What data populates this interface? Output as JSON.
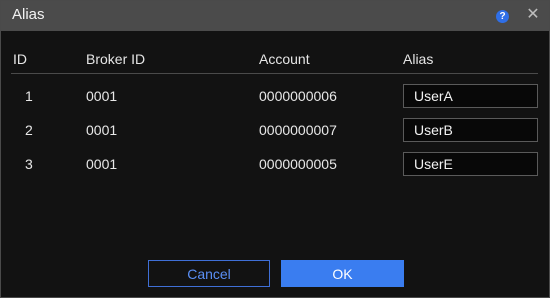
{
  "window": {
    "title": "Alias",
    "help_icon": "help-icon",
    "close_icon": "close-icon",
    "help_glyph": "?",
    "close_glyph": "✕"
  },
  "table": {
    "headers": {
      "id": "ID",
      "broker_id": "Broker ID",
      "account": "Account",
      "alias": "Alias"
    },
    "rows": [
      {
        "id": "1",
        "broker_id": "0001",
        "account": "0000000006",
        "alias": "UserA"
      },
      {
        "id": "2",
        "broker_id": "0001",
        "account": "0000000007",
        "alias": "UserB"
      },
      {
        "id": "3",
        "broker_id": "0001",
        "account": "0000000005",
        "alias": "UserE"
      }
    ]
  },
  "buttons": {
    "cancel": "Cancel",
    "ok": "OK"
  },
  "colors": {
    "background": "#121212",
    "titlebar": "#4b4b4b",
    "accent": "#3a7df0",
    "help_icon": "#2f6fe8"
  }
}
